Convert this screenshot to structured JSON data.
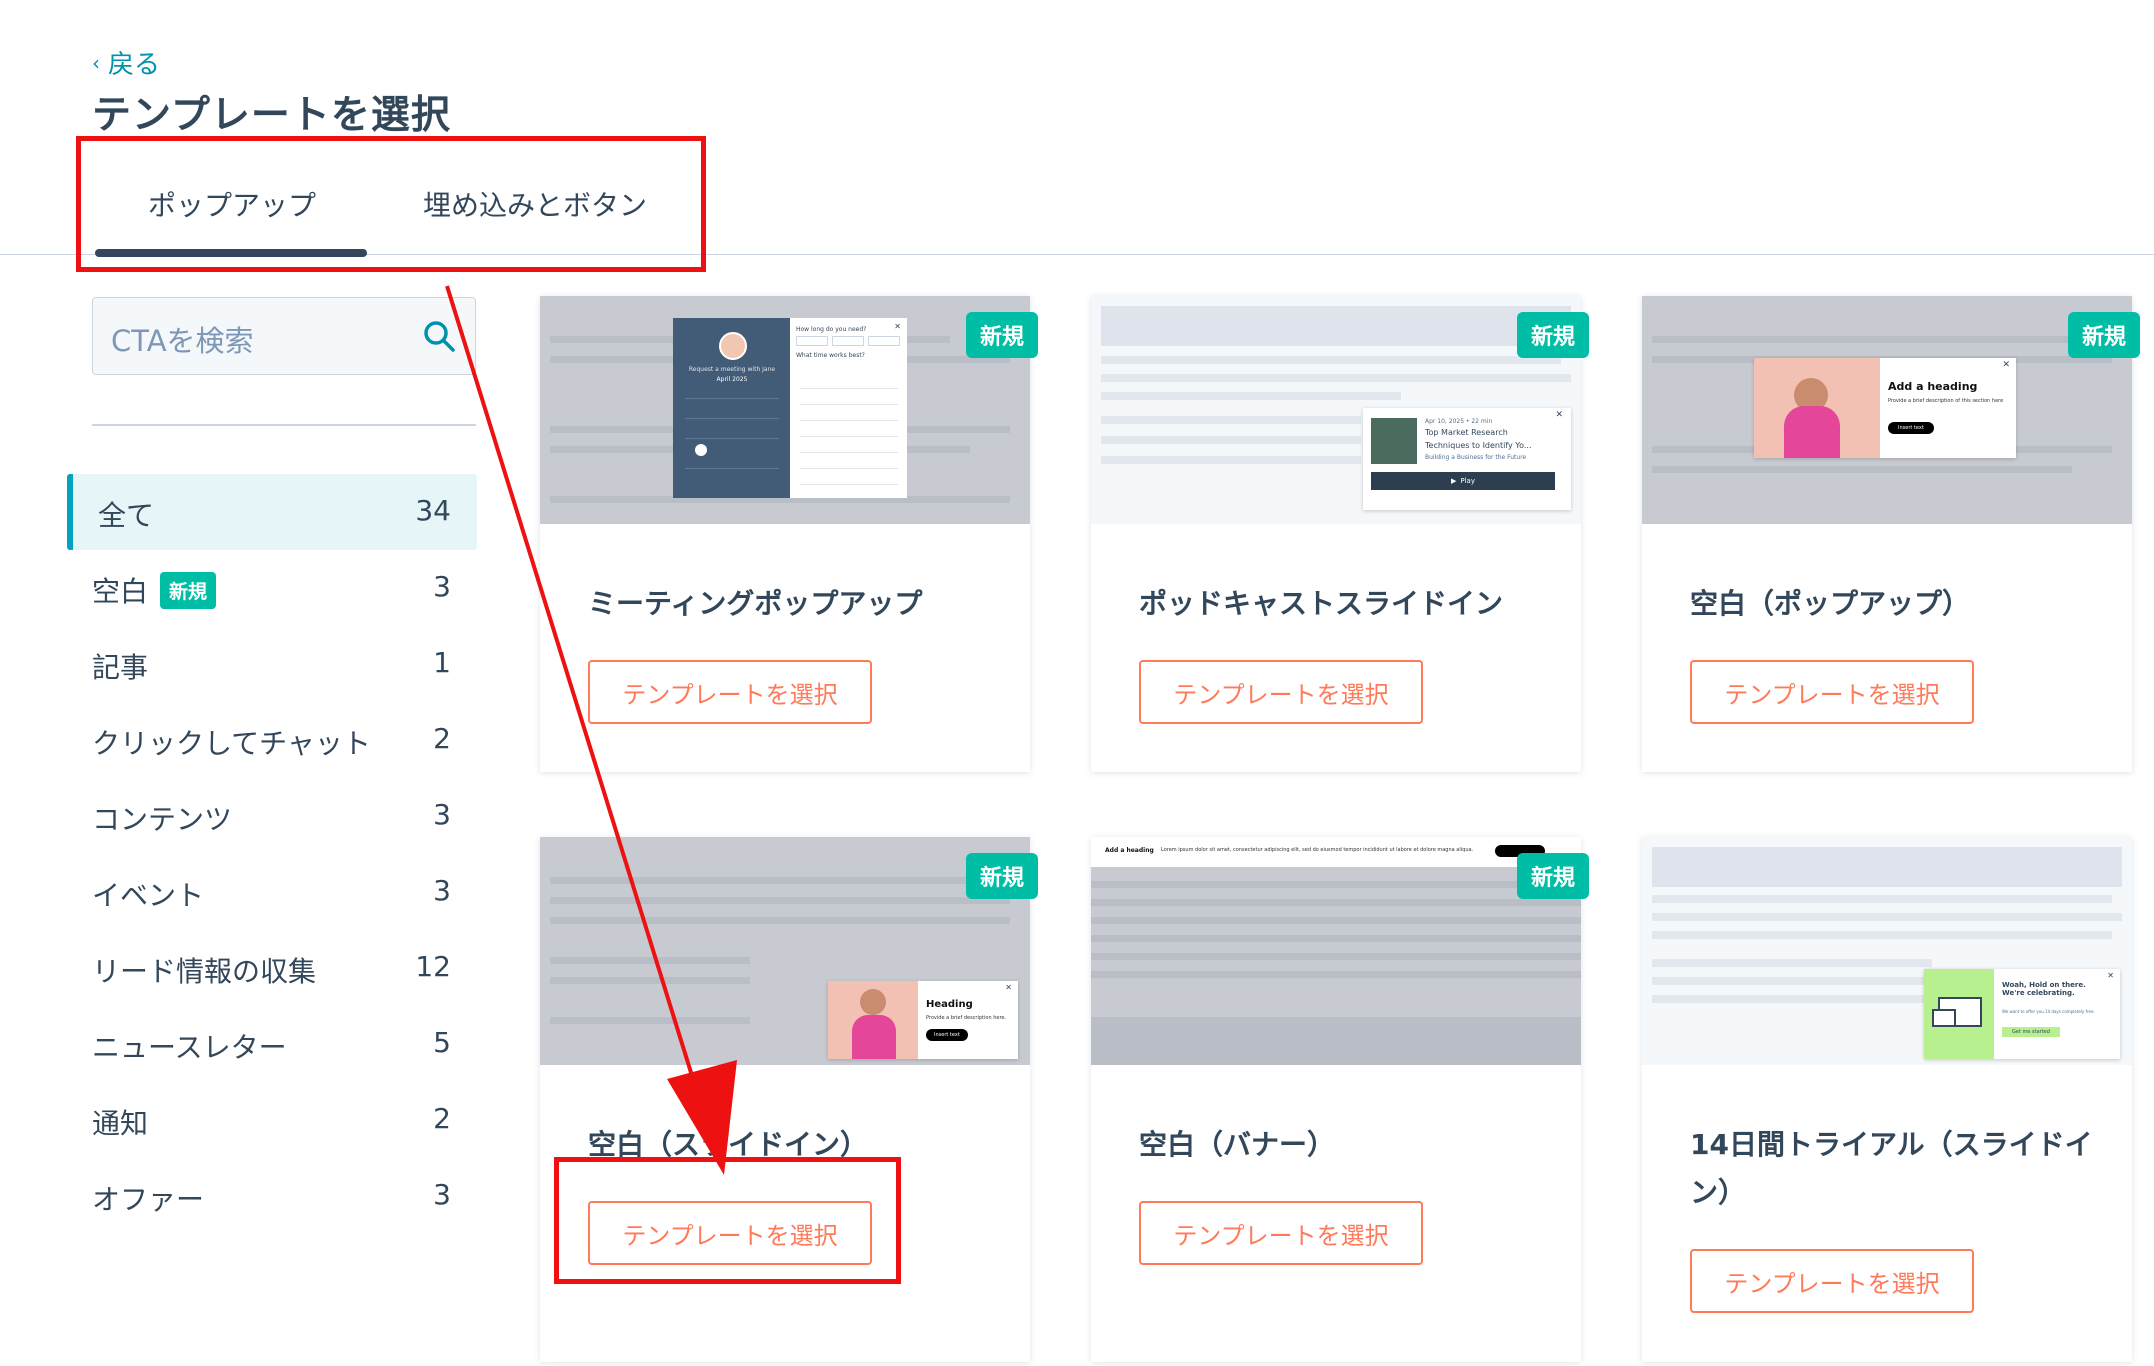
{
  "header": {
    "back_label": "戻る",
    "title": "テンプレートを選択"
  },
  "tabs": [
    {
      "label": "ポップアップ",
      "active": true
    },
    {
      "label": "埋め込みとボタン",
      "active": false
    }
  ],
  "search": {
    "placeholder": "CTAを検索"
  },
  "sidebar": {
    "items": [
      {
        "label": "全て",
        "count": "34",
        "active": true
      },
      {
        "label": "空白",
        "badge": "新規",
        "count": "3"
      },
      {
        "label": "記事",
        "count": "1"
      },
      {
        "label": "クリックしてチャット",
        "count": "2"
      },
      {
        "label": "コンテンツ",
        "count": "3"
      },
      {
        "label": "イベント",
        "count": "3"
      },
      {
        "label": "リード情報の収集",
        "count": "12"
      },
      {
        "label": "ニュースレター",
        "count": "5"
      },
      {
        "label": "通知",
        "count": "2"
      },
      {
        "label": "オファー",
        "count": "3"
      }
    ]
  },
  "cards": [
    {
      "title": "ミーティングポップアップ",
      "badge": "新規",
      "button": "テンプレートを選択",
      "preview": {
        "text1": "Request a meeting with Jane",
        "text2": "April 2025",
        "text3": "How long do you need?",
        "text4": "What time works best?"
      }
    },
    {
      "title": "ポッドキャストスライドイン",
      "badge": "新規",
      "button": "テンプレートを選択",
      "preview": {
        "meta": "Apr 10, 2025 • 22 min",
        "line1": "Top Market Research",
        "line2": "Techniques to Identify Yo...",
        "line3": "Building a Business for the Future",
        "play": "Play"
      }
    },
    {
      "title": "空白（ポップアップ）",
      "badge": "新規",
      "button": "テンプレートを選択",
      "preview": {
        "heading": "Add a heading",
        "desc": "Provide a brief description of this section here",
        "cta": "Insert text"
      }
    },
    {
      "title": "空白（スライドイン）",
      "badge": "新規",
      "button": "テンプレートを選択",
      "preview": {
        "heading": "Heading",
        "desc": "Provide a brief description here.",
        "cta": "Insert text"
      }
    },
    {
      "title": "空白（バナー）",
      "badge": "新規",
      "button": "テンプレートを選択",
      "preview": {
        "heading": "Add a heading",
        "desc": "Lorem ipsum dolor sit amet, consectetur adipiscing elit, sed do eiusmod tempor incididunt ut labore et dolore magna aliqua."
      }
    },
    {
      "title": "14日間トライアル（スライドイン）",
      "badge": "",
      "button": "テンプレートを選択",
      "preview": {
        "heading": "Woah, Hold on there. We're celebrating.",
        "desc": "We want to offer you 14 days completely free.",
        "cta": "Get me started"
      }
    }
  ],
  "colors": {
    "accent_teal": "#00a4bd",
    "badge_green": "#00bda5",
    "button_orange": "#ff7a59",
    "annotation_red": "#ee1111",
    "text_dark": "#33475b"
  }
}
